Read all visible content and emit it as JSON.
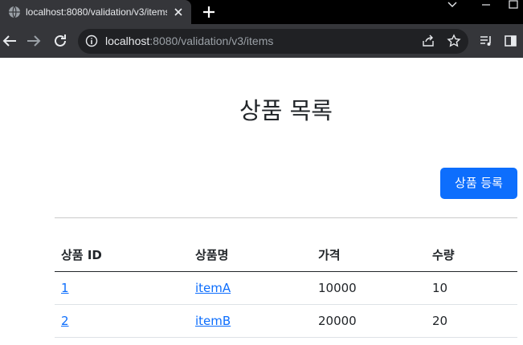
{
  "browser": {
    "tab_title": "localhost:8080/validation/v3/items",
    "url_host": "localhost",
    "url_rest": ":8080/validation/v3/items"
  },
  "page": {
    "title": "상품 목록",
    "register_button": "상품 등록"
  },
  "table": {
    "headers": [
      "상품 ID",
      "상품명",
      "가격",
      "수량"
    ],
    "rows": [
      {
        "id": "1",
        "name": "itemA",
        "price": "10000",
        "quantity": "10"
      },
      {
        "id": "2",
        "name": "itemB",
        "price": "20000",
        "quantity": "20"
      }
    ]
  },
  "colors": {
    "accent": "#0d6efd",
    "chrome_dark": "#35363a",
    "tabstrip": "#000000"
  }
}
